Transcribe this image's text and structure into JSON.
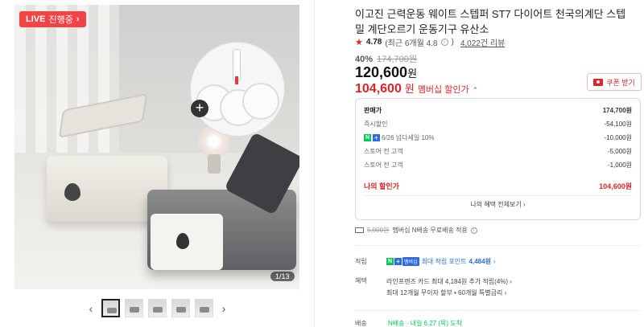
{
  "gallery": {
    "live_badge": "LIVE",
    "live_sub": "진행중",
    "page_count": "1/13"
  },
  "product": {
    "title": "이고진 근력운동 웨이트 스텝퍼 ST7 다이어트 천국의계단 스텝밀 계단오르기 운동기구 유산소",
    "rating_score": "4.78",
    "rating_recent": "(최근 6개월 4.8",
    "reviews": "4,022건 리뷰",
    "discount_pct": "40%",
    "original_price": "174,700원",
    "price": "120,600",
    "price_unit": "원",
    "member_price": "104,600",
    "member_unit": "원",
    "member_label": "멤버십 할인가",
    "coupon_label": "쿠폰 받기"
  },
  "benefits": {
    "rows": [
      {
        "label": "판매가",
        "amount": "174,700원"
      },
      {
        "label": "즉시할인",
        "amount": "-54,100원"
      },
      {
        "label": "6/26 넘다세일 10%",
        "amount": "-10,000원"
      },
      {
        "label": "스토어 전 고객",
        "amount": "-5,000원"
      },
      {
        "label": "스토어 전 고객",
        "amount": "-1,000원"
      }
    ],
    "my_label": "나의 할인가",
    "my_amount": "104,600원",
    "more_label": "나의 혜택 전체보기"
  },
  "shipping": {
    "strike": "5,000원",
    "text": "멤버십 N배송 무료배송 적용"
  },
  "points": {
    "label": "적립",
    "membership_badge": "멤버십",
    "text": "최대 적립 포인트",
    "value": "4,484원"
  },
  "card_benefits": {
    "label": "혜택",
    "line1": "라인프렌즈 카드 최대 4,184원 추가 적립(4%)",
    "line2": "최대 12개월 무이자 할부 • 60개월 특별금리"
  },
  "delivery": {
    "label": "배송",
    "text": "N배송 · 내일 6.27 (목) 도착"
  }
}
